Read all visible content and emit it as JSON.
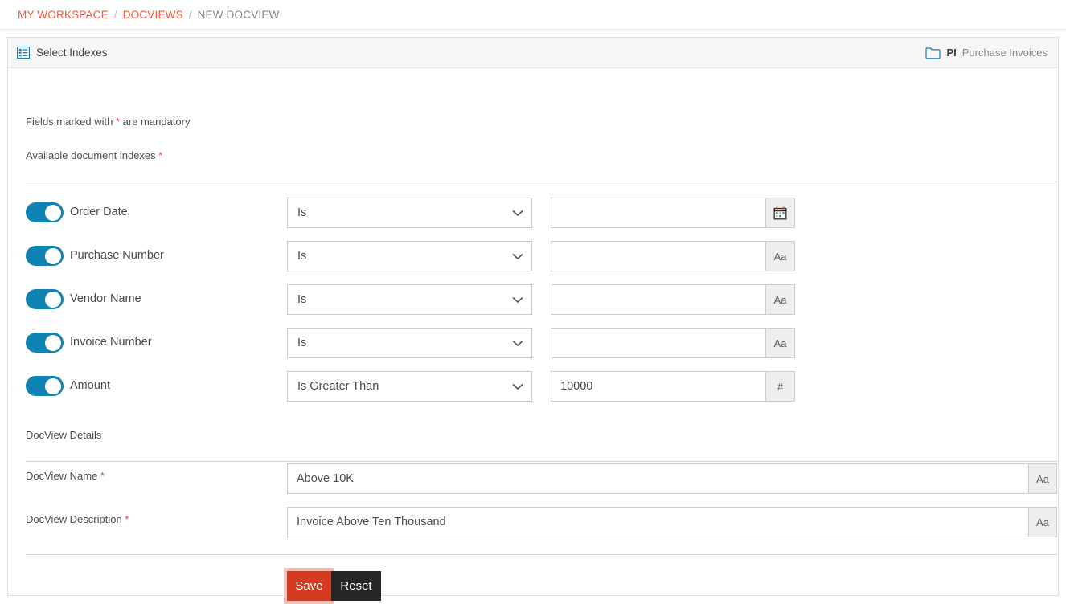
{
  "breadcrumb": {
    "items": [
      {
        "label": "MY WORKSPACE",
        "type": "link"
      },
      {
        "label": "DOCVIEWS",
        "type": "link"
      },
      {
        "label": "NEW DOCVIEW",
        "type": "current"
      }
    ],
    "separator": "/"
  },
  "panel": {
    "title": "Select Indexes",
    "title_icon": "list-indexes-icon",
    "folder_icon": "folder-icon",
    "folder_code": "PI",
    "folder_name": "Purchase Invoices"
  },
  "form": {
    "mandatory_note_prefix": "Fields marked with ",
    "mandatory_note_star": "*",
    "mandatory_note_suffix": " are mandatory",
    "available_indexes_label": "Available document indexes",
    "available_indexes_star": "*",
    "details_label": "DocView Details"
  },
  "indexes": [
    {
      "label": "Order Date",
      "enabled": true,
      "operator": "Is",
      "value": "",
      "addon": "calendar-icon",
      "addon_type": "date",
      "input_name": "order-date-value-input"
    },
    {
      "label": "Purchase Number",
      "enabled": true,
      "operator": "Is",
      "value": "",
      "addon": "Aa",
      "addon_type": "text",
      "input_name": "purchase-number-value-input"
    },
    {
      "label": "Vendor Name",
      "enabled": true,
      "operator": "Is",
      "value": "",
      "addon": "Aa",
      "addon_type": "text",
      "input_name": "vendor-name-value-input"
    },
    {
      "label": "Invoice Number",
      "enabled": true,
      "operator": "Is",
      "value": "",
      "addon": "Aa",
      "addon_type": "text",
      "input_name": "invoice-number-value-input"
    },
    {
      "label": "Amount",
      "enabled": true,
      "operator": "Is Greater Than",
      "value": "10000",
      "addon": "#",
      "addon_type": "number",
      "input_name": "amount-value-input"
    }
  ],
  "details": {
    "name_label": "DocView Name",
    "name_star": "*",
    "name_value": "Above 10K",
    "name_addon": "Aa",
    "description_label": "DocView Description",
    "description_star": "*",
    "description_value": "Invoice Above Ten Thousand",
    "description_addon": "Aa"
  },
  "actions": {
    "save_label": "Save",
    "reset_label": "Reset"
  },
  "colors": {
    "breadcrumb_link": "#ef5a3d",
    "toggle_on": "#0f83b2",
    "save_button": "#d63b22",
    "save_focus_ring": "#f7bdb2",
    "reset_button": "#262626",
    "required_star": "#e8453c",
    "panel_header_bg": "#f6f6f6"
  }
}
